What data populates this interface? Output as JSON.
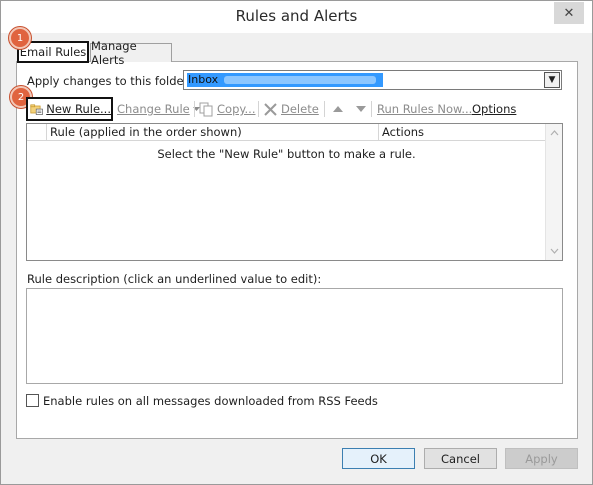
{
  "window": {
    "title": "Rules and Alerts",
    "close_glyph": "✕"
  },
  "tabs": [
    {
      "label": "Email Rules",
      "selected": true
    },
    {
      "label": "Manage Alerts",
      "selected": false
    }
  ],
  "callouts": [
    "1",
    "2"
  ],
  "folder": {
    "label": "Apply changes to this folder:",
    "value": "Inbox",
    "arrow_glyph": "▼"
  },
  "toolbar": {
    "new_rule": "New Rule...",
    "change_rule": "Change Rule",
    "copy": "Copy...",
    "delete": "Delete",
    "run_rules_now": "Run Rules Now...",
    "options": "Options"
  },
  "rules_table": {
    "columns": [
      "Rule (applied in the order shown)",
      "Actions"
    ],
    "empty_message": "Select the \"New Rule\" button to make a rule.",
    "rows": []
  },
  "description": {
    "label": "Rule description (click an underlined value to edit):",
    "text": ""
  },
  "rss": {
    "label": "Enable rules on all messages downloaded from RSS Feeds",
    "checked": false
  },
  "buttons": {
    "ok": "OK",
    "cancel": "Cancel",
    "apply": "Apply"
  },
  "colors": {
    "callout": "#e0643f",
    "selection": "#3399ff",
    "disabled_text": "#8c8c8c"
  },
  "icons": [
    "new-rule-icon",
    "change-rule-dropdown-icon",
    "copy-icon",
    "delete-icon",
    "move-up-icon",
    "move-down-icon",
    "close-icon"
  ]
}
